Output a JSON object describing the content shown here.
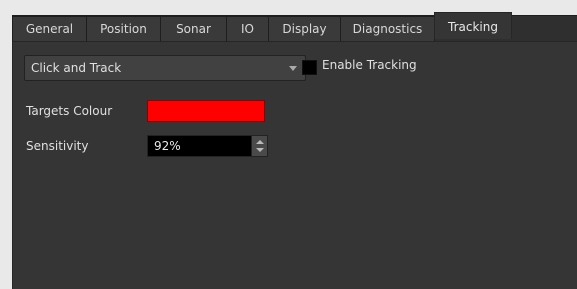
{
  "tabs": [
    {
      "label": "General"
    },
    {
      "label": "Position"
    },
    {
      "label": "Sonar"
    },
    {
      "label": "IO"
    },
    {
      "label": "Display"
    },
    {
      "label": "Diagnostics"
    },
    {
      "label": "Tracking",
      "active": true
    }
  ],
  "tracking": {
    "mode_select": {
      "value": "Click and Track",
      "icon": "chevron-down-icon"
    },
    "enable_tracking": {
      "label": "Enable Tracking",
      "checked": false
    },
    "targets_colour": {
      "label": "Targets Colour",
      "color": "#ff0000"
    },
    "sensitivity": {
      "label": "Sensitivity",
      "value": "92%"
    }
  }
}
